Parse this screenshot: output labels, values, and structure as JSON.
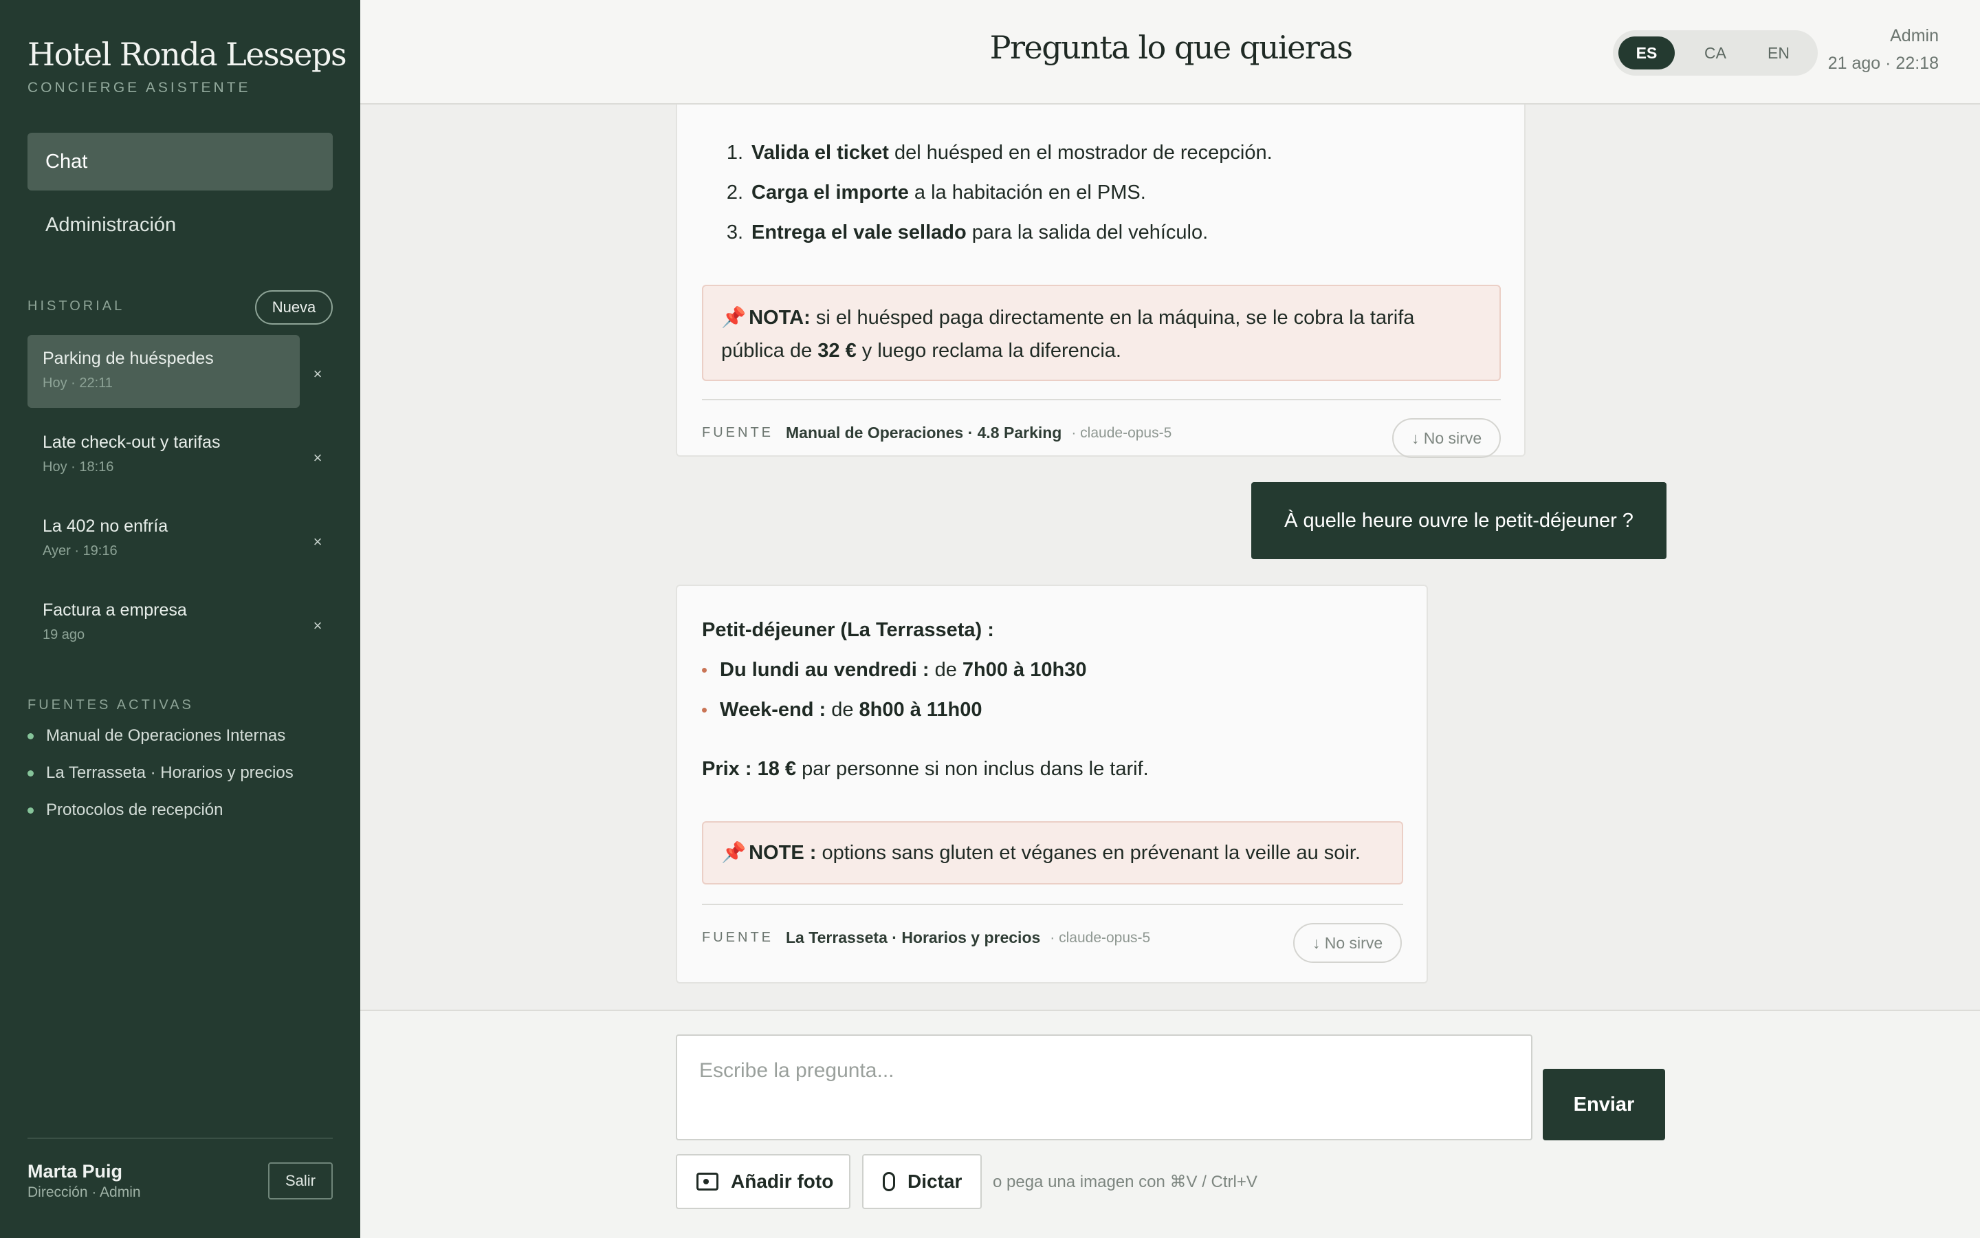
{
  "sidebar": {
    "brand": "Hotel Ronda Lesseps",
    "brand_sub": "CONCIERGE ASISTENTE",
    "nav": [
      {
        "label": "Chat",
        "active": true
      },
      {
        "label": "Administración",
        "active": false
      }
    ],
    "history_label": "HISTORIAL",
    "new_label": "Nueva",
    "history": [
      {
        "title": "Parking de huéspedes",
        "time": "Hoy · 22:11",
        "active": true,
        "close": "×"
      },
      {
        "title": "Late check-out y tarifas",
        "time": "Hoy · 18:16",
        "active": false,
        "close": "×"
      },
      {
        "title": "La 402 no enfría",
        "time": "Ayer · 19:16",
        "active": false,
        "close": "×"
      },
      {
        "title": "Factura a empresa",
        "time": "19 ago",
        "active": false,
        "close": "×"
      }
    ],
    "sources_label": "FUENTES ACTIVAS",
    "sources": [
      "Manual de Operaciones Internas",
      "La Terrasseta · Horarios y precios",
      "Protocolos de recepción"
    ],
    "user": {
      "name": "Marta Puig",
      "role": "Dirección · Admin"
    },
    "logout_label": "Salir"
  },
  "header": {
    "title": "Pregunta lo que quieras",
    "languages": [
      {
        "code": "ES",
        "active": true
      },
      {
        "code": "CA",
        "active": false
      },
      {
        "code": "EN",
        "active": false
      }
    ],
    "admin_label": "Admin",
    "datetime": "21 ago · 22:18"
  },
  "chat": {
    "msg1": {
      "steps": [
        {
          "num": "1.",
          "bold": "Valida el ticket",
          "rest": " del huésped en el mostrador de recepción."
        },
        {
          "num": "2.",
          "bold": "Carga el importe",
          "rest": " a la habitación en el PMS."
        },
        {
          "num": "3.",
          "bold": "Entrega el vale sellado",
          "rest": " para la salida del vehículo."
        }
      ],
      "note": {
        "pin": "📌",
        "label": "NOTA:",
        "line1": " si el huésped paga directamente en la máquina, se le cobra la tarifa",
        "line2_pre": "pública de ",
        "line2_bold": "32 €",
        "line2_post": " y luego reclama la diferencia."
      },
      "source_key": "FUENTE",
      "source": "Manual de Operaciones · 4.8 Parking",
      "model": "· claude-opus-5",
      "feedback": "↓ No sirve"
    },
    "user_message": "À quelle heure ouvre le petit-déjeuner ?",
    "msg2": {
      "heading": "Petit-déjeuner (La Terrasseta) :",
      "items": [
        {
          "bold": "Du lundi au vendredi :",
          "mid": " de ",
          "bold2": "7h00 à 10h30"
        },
        {
          "bold": "Week-end :",
          "mid": " de ",
          "bold2": "8h00 à 11h00"
        }
      ],
      "price_bold": "Prix : 18 €",
      "price_rest": " par personne si non inclus dans le tarif.",
      "note": {
        "pin": "📌",
        "label": "NOTE :",
        "text": " options sans gluten et véganes en prévenant la veille au soir."
      },
      "source_key": "FUENTE",
      "source": "La Terrasseta · Horarios y precios",
      "model": "· claude-opus-5",
      "feedback": "↓ No sirve"
    }
  },
  "composer": {
    "placeholder": "Escribe la pregunta...",
    "send_label": "Enviar",
    "photo_label": "Añadir foto",
    "dictate_label": "Dictar",
    "paste_hint": "o pega una imagen con ⌘V / Ctrl+V"
  },
  "colors": {
    "sidebar_bg": "#243a30",
    "accent": "#243a30",
    "note_bg": "#f8ece8",
    "source_dot": "#86c49a"
  }
}
